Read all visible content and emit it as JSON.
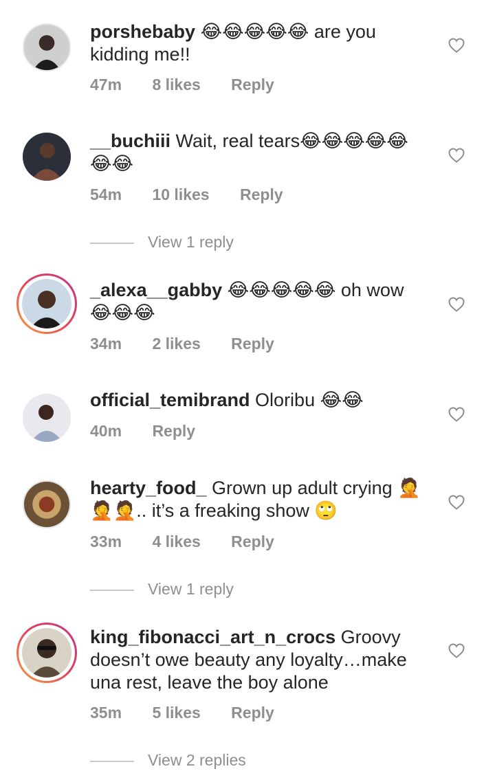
{
  "comments": [
    {
      "username": "porshebaby",
      "text_before": "",
      "emoji": "😂😂😂😂😂",
      "text_after": " are you kidding me!!",
      "time": "47m",
      "likes": "8 likes",
      "reply": "Reply"
    },
    {
      "username": "__buchiii",
      "text_before": " Wait, real tears",
      "emoji": "😂😂😂😂😂😂😂",
      "text_after": "",
      "time": "54m",
      "likes": "10 likes",
      "reply": "Reply",
      "view_replies": "View 1 reply"
    },
    {
      "username": "_alexa__gabby",
      "text_before": "",
      "emoji": "😂😂😂😂😂",
      "text_after": " oh wow",
      "emoji2": "😂😂😂",
      "time": "34m",
      "likes": "2 likes",
      "reply": "Reply"
    },
    {
      "username": "official_temibrand",
      "text_before": " Oloribu ",
      "emoji": "😂😂",
      "text_after": "",
      "time": "40m",
      "reply": "Reply"
    },
    {
      "username": "hearty_food_",
      "text_before": " Grown up adult crying ",
      "emoji": "🤦🤦🤦",
      "text_after": ".. it’s a freaking show ",
      "emoji2": "🙄",
      "time": "33m",
      "likes": "4 likes",
      "reply": "Reply",
      "view_replies": "View 1 reply"
    },
    {
      "username": "king_fibonacci_art_n_crocs",
      "text_before": " Groovy doesn’t owe beauty any loyalty…make una rest, leave the boy alone",
      "emoji": "",
      "text_after": "",
      "time": "35m",
      "likes": "5 likes",
      "reply": "Reply",
      "view_replies": "View 2 replies"
    }
  ],
  "icons": {
    "like": "heart-outline-icon"
  },
  "colors": {
    "meta": "#8e8e8e",
    "ring_start": "#f7a23a",
    "ring_end": "#c13584"
  }
}
